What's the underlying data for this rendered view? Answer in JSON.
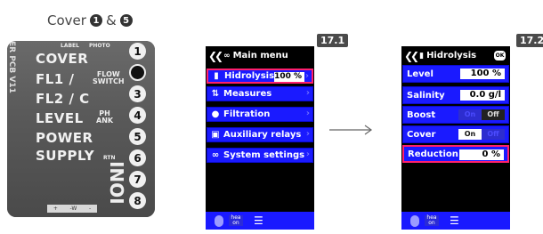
{
  "header": {
    "title": "Cover",
    "sep": "&",
    "num_a": "1",
    "num_b": "5"
  },
  "photo": {
    "side_text": "ER PCB V11",
    "top_small_a": "LABEL",
    "top_small_b": "PHOTO",
    "labels": [
      "COVER",
      "FL1 /",
      "FL2 / C",
      "LEVEL",
      "POWER",
      "SUPPLY"
    ],
    "flow_switch": "FLOW\nSWITCH",
    "ph_tank": "PH\nANK",
    "rtn": "RTN",
    "ioni": "IONI",
    "pins": [
      "1",
      "2",
      "3",
      "4",
      "5",
      "6",
      "7",
      "8"
    ],
    "strip": [
      "+",
      "-W",
      "-"
    ]
  },
  "steps": {
    "a": "17.1",
    "b": "17.2"
  },
  "screen1": {
    "title": "Main menu",
    "items": [
      {
        "label": "Hidrolysis",
        "value": "100 %"
      },
      {
        "label": "Measures"
      },
      {
        "label": "Filtration"
      },
      {
        "label": "Auxiliary relays"
      },
      {
        "label": "System settings"
      }
    ],
    "bottom_text": "hea on"
  },
  "screen2": {
    "title": "Hidrolysis",
    "ok": "OK",
    "rows": {
      "level": {
        "label": "Level",
        "value": "100 %"
      },
      "salinity": {
        "label": "Salinity",
        "value": "0.0 g/l"
      },
      "boost": {
        "label": "Boost",
        "on": "On",
        "off": "Off"
      },
      "cover": {
        "label": "Cover",
        "on": "On",
        "off": "Off"
      },
      "reduction": {
        "label": "Reduction",
        "value": "0 %"
      }
    },
    "bottom_text": "hea on"
  },
  "colors": {
    "accent": "#1a1aff",
    "highlight": "#ff1f6e",
    "screen_bg": "#000000"
  }
}
